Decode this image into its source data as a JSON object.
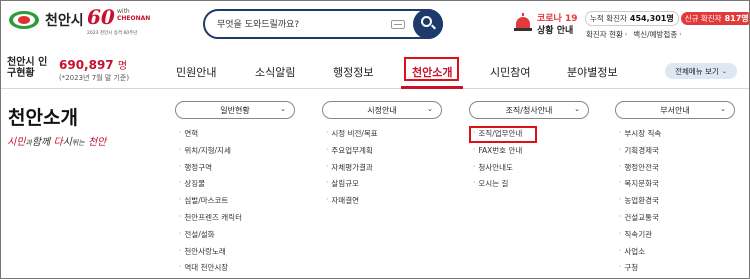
{
  "header": {
    "logo_text": "천안시",
    "anniversary": {
      "number": "60",
      "with": "with",
      "brand": "CHEONAN",
      "subtitle": "2023 천안시 승격 60주년"
    },
    "search": {
      "placeholder": "무엇을 도와드릴까요?"
    },
    "covid": {
      "title": "코로나 19",
      "subtitle": "상황 안내",
      "total_label": "누적 확진자",
      "total_value": "454,301명",
      "new_label": "신규 확진자",
      "new_value": "817명",
      "link1": "확진자 현황",
      "link2": "백신/예방접종"
    }
  },
  "population": {
    "label": "천안시 인구현황",
    "number": "690,897",
    "unit": "명",
    "date": "(*2023년 7월 말 기준)"
  },
  "nav": {
    "items": [
      "민원안내",
      "소식알림",
      "행정정보",
      "천안소개",
      "시민참여",
      "분야별정보"
    ],
    "active": "천안소개",
    "all_menu": "전체메뉴 보기"
  },
  "page": {
    "title": "천안소개",
    "slogan": {
      "p1": "시민",
      "p2": "과",
      "p3": "함께",
      "p4": "다",
      "p5": "시",
      "p6": "뛰는",
      "p7": "천안"
    }
  },
  "columns": [
    {
      "head": "일반현황",
      "items": [
        "연혁",
        "위치/지형/지세",
        "행정구역",
        "상징물",
        "심벌/마스코트",
        "천안프렌즈 캐릭터",
        "전설/설화",
        "천안사랑노래",
        "역대 천안시장"
      ]
    },
    {
      "head": "시정안내",
      "items": [
        "시정 비전/목표",
        "주요업무계획",
        "자체평가결과",
        "살림규모",
        "자매결연"
      ]
    },
    {
      "head": "조직/청사안내",
      "items": [
        "조직/업무안내",
        "FAX번호 안내",
        "청사안내도",
        "오시는 길"
      ]
    },
    {
      "head": "부서안내",
      "items": [
        "부시장 직속",
        "기획경제국",
        "행정안전국",
        "복지문화국",
        "농업환경국",
        "건설교통국",
        "직속기관",
        "사업소",
        "구청"
      ]
    }
  ]
}
